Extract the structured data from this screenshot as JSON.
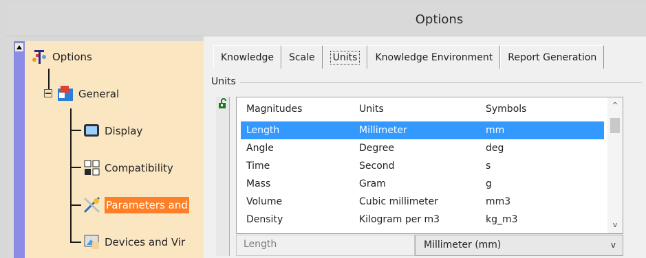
{
  "window": {
    "title": "Options"
  },
  "tree": {
    "root": "Options",
    "general": "General",
    "children": [
      "Display",
      "Compatibility",
      "Parameters and",
      "Devices and Vir"
    ],
    "selected_index": 2
  },
  "tabs": [
    "Knowledge",
    "Scale",
    "Units",
    "Knowledge Environment",
    "Report Generation"
  ],
  "active_tab": "Units",
  "units_group": {
    "label": "Units",
    "columns": [
      "Magnitudes",
      "Units",
      "Symbols"
    ],
    "rows": [
      [
        "Length",
        "Millimeter",
        "mm"
      ],
      [
        "Angle",
        "Degree",
        "deg"
      ],
      [
        "Time",
        "Second",
        "s"
      ],
      [
        "Mass",
        "Gram",
        "g"
      ],
      [
        "Volume",
        "Cubic millimeter",
        "mm3"
      ],
      [
        "Density",
        "Kilogram per m3",
        "kg_m3"
      ]
    ],
    "selected_row": 0,
    "selected_magnitude": "Length",
    "selected_unit": "Millimeter (mm)"
  },
  "icons": {
    "scroll_up": "▲",
    "scroll_down": "▼",
    "chevron_up": "^",
    "chevron_down": "v"
  },
  "colors": {
    "tree_background": "#fbe6c2",
    "tree_scroll": "#8c8ce6",
    "selection_blue": "#3399ff",
    "tree_selection": "#ff7f27"
  }
}
